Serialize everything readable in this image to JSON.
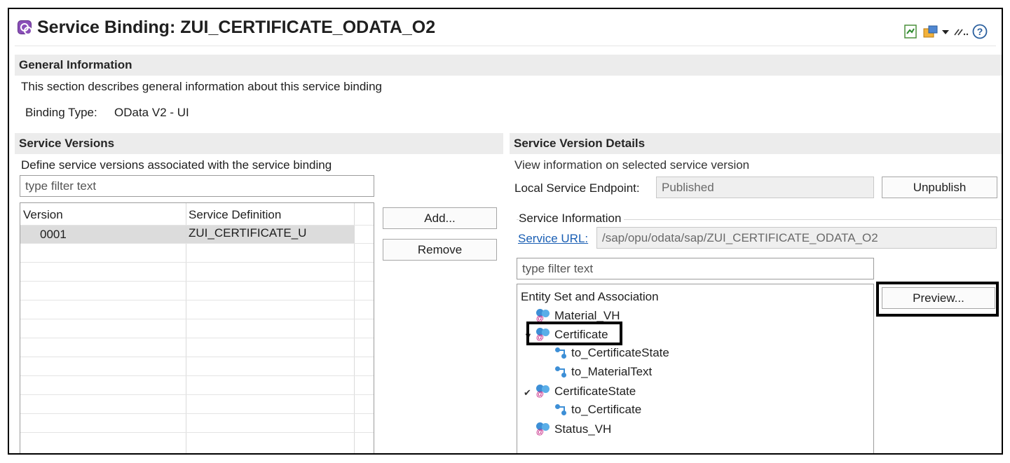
{
  "header": {
    "title": "Service Binding: ZUI_CERTIFICATE_ODATA_O2",
    "icons": [
      "service-binding-icon",
      "publish-icon",
      "deploy-icon",
      "dropdown-icon",
      "link-icon",
      "help-icon"
    ]
  },
  "general": {
    "heading": "General Information",
    "description": "This section describes general information about this service binding",
    "binding_type_label": "Binding Type:",
    "binding_type_value": "OData V2 - UI"
  },
  "versions": {
    "heading": "Service Versions",
    "description": "Define service versions associated with the service binding",
    "filter_placeholder": "type filter text",
    "columns": [
      "Version",
      "Service Definition"
    ],
    "rows": [
      {
        "version": "0001",
        "definition": "ZUI_CERTIFICATE_U"
      }
    ],
    "add_label": "Add...",
    "remove_label": "Remove"
  },
  "details": {
    "heading": "Service Version Details",
    "description": "View information on selected service version",
    "endpoint_label": "Local Service Endpoint:",
    "endpoint_value": "Published",
    "unpublish_label": "Unpublish",
    "service_info_label": "Service Information",
    "service_url_label": "Service URL:",
    "service_url_value": "/sap/opu/odata/sap/ZUI_CERTIFICATE_ODATA_O2",
    "filter_placeholder": "type filter text",
    "tree_header": "Entity Set and Association",
    "tree": [
      {
        "label": "Material_VH",
        "type": "entity"
      },
      {
        "label": "Certificate",
        "type": "entity",
        "expanded": true
      },
      {
        "label": "to_CertificateState",
        "type": "association"
      },
      {
        "label": "to_MaterialText",
        "type": "association"
      },
      {
        "label": "CertificateState",
        "type": "entity",
        "expanded": true
      },
      {
        "label": "to_Certificate",
        "type": "association"
      },
      {
        "label": "Status_VH",
        "type": "entity"
      }
    ],
    "preview_label": "Preview..."
  },
  "colors": {
    "section_bg": "#ececec",
    "link": "#1a5fb4",
    "selection": "#dcdcdc",
    "highlight_border": "#000000"
  }
}
